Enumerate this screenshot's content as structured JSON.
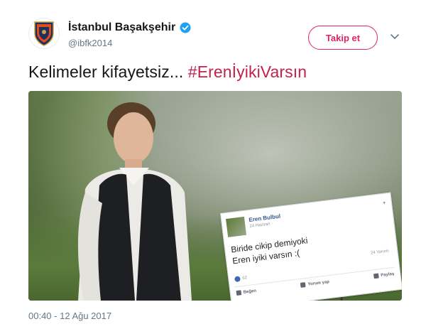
{
  "account": {
    "display_name": "İstanbul Başakşehir",
    "handle": "@ibfk2014",
    "verified": true
  },
  "actions": {
    "follow_label": "Takip et",
    "more_icon": "chevron-down-icon"
  },
  "tweet": {
    "text_plain": "Kelimeler kifayetsiz... ",
    "hashtag": "#ErenİyikiVarsın",
    "timestamp": "00:40 - 12 Ağu 2017"
  },
  "embedded_post": {
    "name": "Eren Bulbul",
    "time": "24 Haziran ·",
    "text_line1": "Biride cikip demiyoki",
    "text_line2": "Eren iyiki varsın :(",
    "comment_count": "24 Yorum",
    "like_count": "62",
    "like_label": "Beğen",
    "comment_label": "Yorum yap",
    "share_label": "Paylaş"
  },
  "colors": {
    "accent": "#e0245e",
    "hashtag": "#c1224f",
    "verified": "#1da1f2",
    "secondary_text": "#657786",
    "facebook_blue": "#365899"
  }
}
